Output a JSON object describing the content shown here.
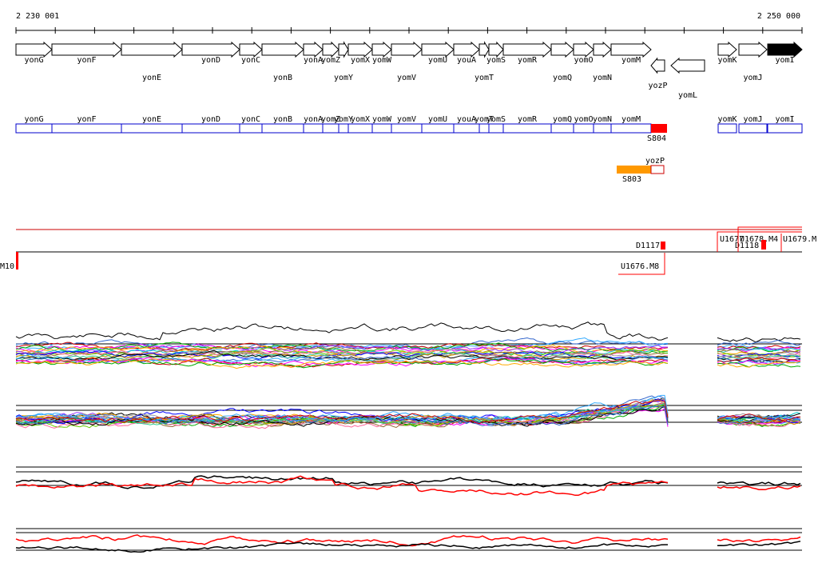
{
  "ruler": {
    "start_label": "2 230 001",
    "end_label": "2 250 000",
    "tick_count": 21
  },
  "genes": [
    {
      "name": "yonG",
      "strand": "+",
      "start": 20,
      "end": 65,
      "row": 0
    },
    {
      "name": "yonF",
      "strand": "+",
      "start": 65,
      "end": 152,
      "row": 0
    },
    {
      "name": "yonE",
      "strand": "+",
      "start": 152,
      "end": 228,
      "row": 1
    },
    {
      "name": "yonD",
      "strand": "+",
      "start": 228,
      "end": 300,
      "row": 0
    },
    {
      "name": "yonC",
      "strand": "+",
      "start": 300,
      "end": 328,
      "row": 0
    },
    {
      "name": "yonB",
      "strand": "+",
      "start": 328,
      "end": 380,
      "row": 1
    },
    {
      "name": "yonA",
      "strand": "+",
      "start": 380,
      "end": 404,
      "row": 0
    },
    {
      "name": "yomZ",
      "strand": "+",
      "start": 404,
      "end": 424,
      "row": 0
    },
    {
      "name": "yomY",
      "strand": "+",
      "start": 424,
      "end": 436,
      "row": 1
    },
    {
      "name": "yomX",
      "strand": "+",
      "start": 436,
      "end": 466,
      "row": 0
    },
    {
      "name": "yomW",
      "strand": "+",
      "start": 466,
      "end": 490,
      "row": 0
    },
    {
      "name": "yomV",
      "strand": "+",
      "start": 490,
      "end": 528,
      "row": 1
    },
    {
      "name": "yomU",
      "strand": "+",
      "start": 528,
      "end": 568,
      "row": 0
    },
    {
      "name": "youA",
      "strand": "+",
      "start": 568,
      "end": 600,
      "row": 0
    },
    {
      "name": "yomT",
      "strand": "+",
      "start": 600,
      "end": 612,
      "row": 1
    },
    {
      "name": "yomS",
      "strand": "+",
      "start": 612,
      "end": 630,
      "row": 0
    },
    {
      "name": "yomR",
      "strand": "+",
      "start": 630,
      "end": 690,
      "row": 0
    },
    {
      "name": "yomQ",
      "strand": "+",
      "start": 690,
      "end": 718,
      "row": 1
    },
    {
      "name": "yomO",
      "strand": "+",
      "start": 718,
      "end": 743,
      "row": 0
    },
    {
      "name": "yomN",
      "strand": "+",
      "start": 743,
      "end": 765,
      "row": 1
    },
    {
      "name": "yomM",
      "strand": "+",
      "start": 765,
      "end": 815,
      "row": 0
    },
    {
      "name": "yozP",
      "strand": "-",
      "start": 815,
      "end": 832,
      "row": 1
    },
    {
      "name": "yomL",
      "strand": "-",
      "start": 840,
      "end": 882,
      "row": 2
    },
    {
      "name": "yomK",
      "strand": "+",
      "start": 899,
      "end": 922,
      "row": 0
    },
    {
      "name": "yomJ",
      "strand": "+",
      "start": 925,
      "end": 960,
      "row": 1
    },
    {
      "name": "yomI",
      "strand": "+",
      "start": 961,
      "end": 1004,
      "row": 0,
      "fill": "#000000"
    }
  ],
  "annotation_track": {
    "boxes": [
      {
        "name": "yonG",
        "start": 20,
        "end": 65
      },
      {
        "name": "yonF",
        "start": 65,
        "end": 152
      },
      {
        "name": "yonE",
        "start": 152,
        "end": 228
      },
      {
        "name": "yonD",
        "start": 228,
        "end": 300
      },
      {
        "name": "yonC",
        "start": 300,
        "end": 328
      },
      {
        "name": "yonB",
        "start": 328,
        "end": 380
      },
      {
        "name": "yonA",
        "start": 380,
        "end": 404
      },
      {
        "name": "yomZ",
        "start": 404,
        "end": 424
      },
      {
        "name": "yomY",
        "start": 424,
        "end": 436
      },
      {
        "name": "yomX",
        "start": 436,
        "end": 466
      },
      {
        "name": "yomW",
        "start": 466,
        "end": 490
      },
      {
        "name": "yomV",
        "start": 490,
        "end": 528
      },
      {
        "name": "yomU",
        "start": 528,
        "end": 568
      },
      {
        "name": "youA",
        "start": 568,
        "end": 600
      },
      {
        "name": "yomT",
        "start": 600,
        "end": 612
      },
      {
        "name": "yomS",
        "start": 612,
        "end": 630
      },
      {
        "name": "yomR",
        "start": 630,
        "end": 690
      },
      {
        "name": "yomQ",
        "start": 690,
        "end": 718
      },
      {
        "name": "yomO",
        "start": 718,
        "end": 743
      },
      {
        "name": "yomN",
        "start": 743,
        "end": 765
      },
      {
        "name": "yomM",
        "start": 765,
        "end": 815
      },
      {
        "name": "yomK",
        "start": 899,
        "end": 922
      },
      {
        "name": "yomJ",
        "start": 925,
        "end": 960
      },
      {
        "name": "yomI",
        "start": 961,
        "end": 1004
      }
    ],
    "highlight": {
      "label": "S804",
      "start": 815,
      "end": 835,
      "color": "#ff0000"
    },
    "secondary": {
      "top_label": "yozP",
      "label": "S803",
      "bar_start": 772,
      "bar_end": 815,
      "box_end": 831,
      "color": "#ff9900"
    }
  },
  "feature_track": {
    "left_label": "M10",
    "items": [
      {
        "label": "D1117"
      },
      {
        "label": "U1676.M8"
      },
      {
        "label": "U1677"
      },
      {
        "label": "U1678.M4"
      },
      {
        "label": "D1118"
      },
      {
        "label": "U1679.M"
      }
    ]
  },
  "colors": {
    "gene_outline": "#000000",
    "annotation_box": "#0000cc",
    "highlight": "#ff0000",
    "secondary": "#ff9900",
    "feature": "#ff0000",
    "profile_palette": [
      "#000000",
      "#3366cc",
      "#33aaff",
      "#cc0000",
      "#ff00ff",
      "#00aa00",
      "#ffaa00",
      "#9933ff",
      "#00cccc",
      "#996633",
      "#66cc00",
      "#ff6699",
      "#0000ff",
      "#999999",
      "#cc9900",
      "#33cc99"
    ]
  }
}
